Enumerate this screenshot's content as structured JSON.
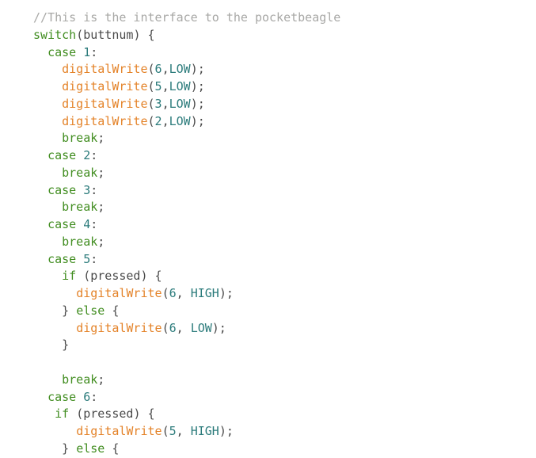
{
  "code": {
    "comment": "//This is the interface to the pocketbeagle",
    "kw_switch": "switch",
    "var_buttnum": "buttnum",
    "kw_case": "case",
    "kw_break": "break",
    "kw_if": "if",
    "kw_else": "else",
    "var_pressed": "pressed",
    "fn_digitalWrite": "digitalWrite",
    "const_LOW": "LOW",
    "const_HIGH": "HIGH",
    "n1": "1",
    "n2": "2",
    "n3": "3",
    "n4": "4",
    "n5": "5",
    "n6": "6"
  }
}
